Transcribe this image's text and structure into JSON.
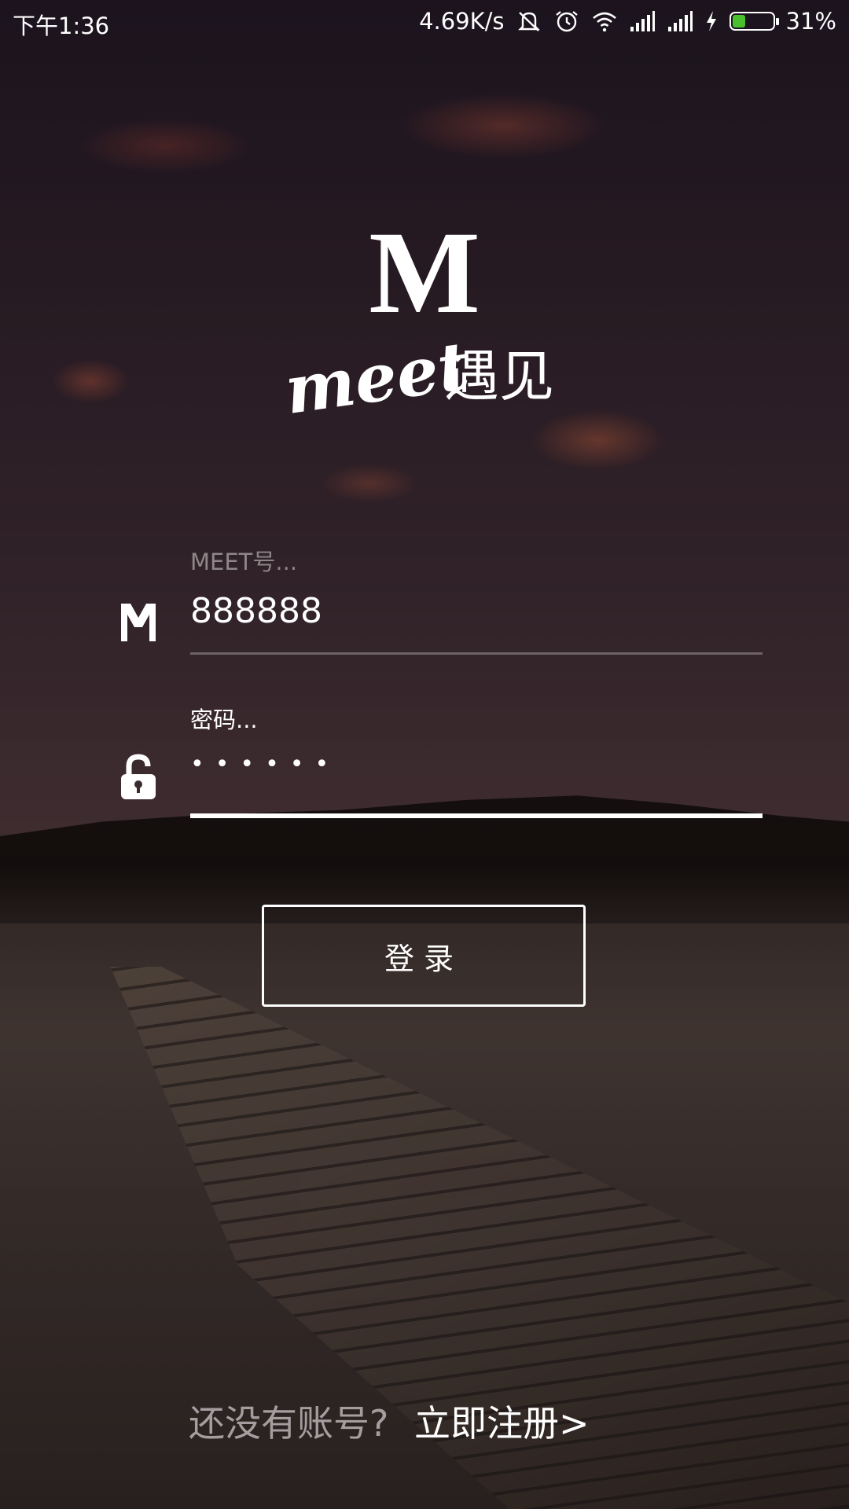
{
  "status_bar": {
    "time": "下午1:36",
    "network_speed": "4.69K/s",
    "battery_percent": "31%",
    "battery_level": 0.31,
    "icons": [
      "mute-icon",
      "alarm-icon",
      "wifi-icon",
      "signal-icon",
      "signal-icon",
      "charging-icon",
      "battery-icon"
    ],
    "battery_fill_color": "#49c12e"
  },
  "logo": {
    "letter": "M",
    "script_text": "meet",
    "chinese_text": "遇见"
  },
  "form": {
    "account": {
      "label": "MEET号...",
      "value": "888888",
      "icon": "m-logo-icon"
    },
    "password": {
      "label": "密码...",
      "masked_value": "••••••",
      "icon": "unlock-icon"
    }
  },
  "login_button": {
    "label": "登录"
  },
  "register": {
    "prompt": "还没有账号?",
    "link": "立即注册>"
  },
  "colors": {
    "text": "#ffffff",
    "muted_text": "#a59ea0",
    "inactive_line": "#6d6266",
    "active_line": "#ffffff"
  }
}
